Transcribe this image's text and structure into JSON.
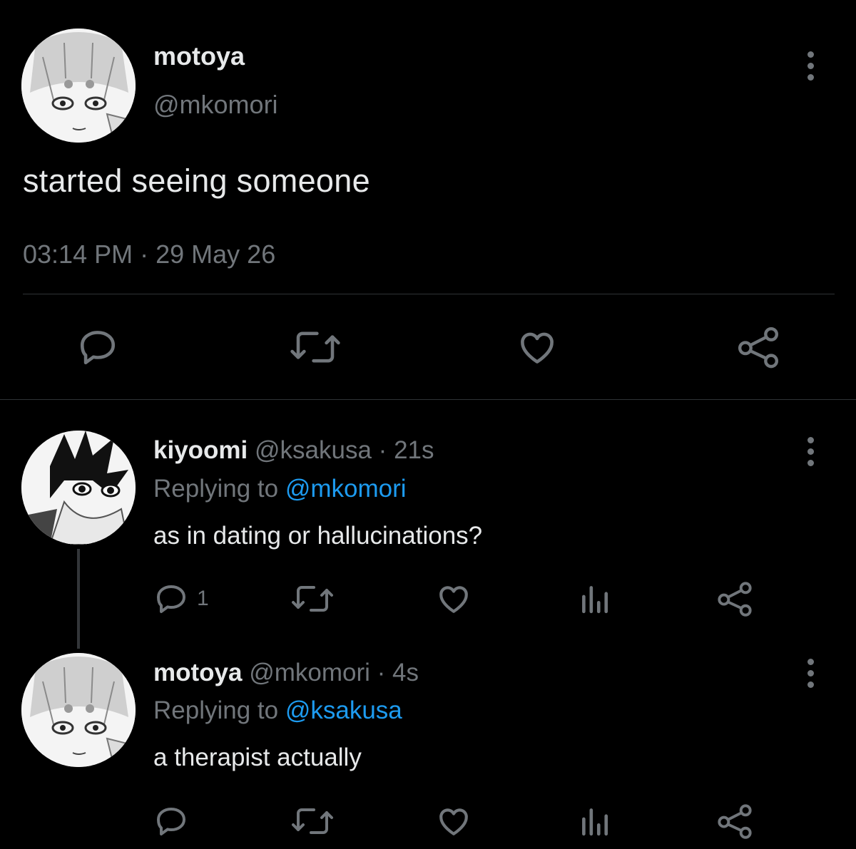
{
  "main_tweet": {
    "author_name": "motoya",
    "author_handle": "@mkomori",
    "text": "started seeing someone",
    "time": "03:14 PM",
    "sep": "·",
    "date": "29 May 26"
  },
  "replies": [
    {
      "author_name": "kiyoomi",
      "author_handle": "@ksakusa",
      "sep": "·",
      "age": "21s",
      "replying_prefix": "Replying to",
      "replying_to": "@mkomori",
      "text": "as in dating or hallucinations?",
      "reply_count": "1"
    },
    {
      "author_name": "motoya",
      "author_handle": "@mkomori",
      "sep": "·",
      "age": "4s",
      "replying_prefix": "Replying to",
      "replying_to": "@ksakusa",
      "text": "a therapist actually"
    }
  ],
  "icons": [
    "reply-icon",
    "retweet-icon",
    "like-icon",
    "share-icon",
    "analytics-icon",
    "more-icon"
  ],
  "colors": {
    "background": "#000000",
    "text": "#e7e9ea",
    "muted": "#71767b",
    "accent": "#1d9bf0"
  }
}
